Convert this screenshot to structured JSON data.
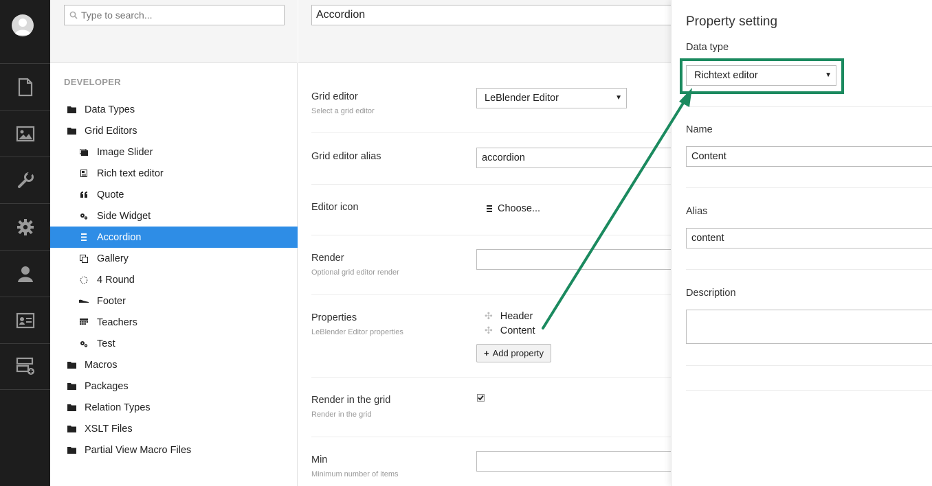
{
  "tree": {
    "search_placeholder": "Type to search...",
    "section_title": "DEVELOPER",
    "items": [
      {
        "label": "Data Types",
        "level": 1,
        "icon": "folder-icon"
      },
      {
        "label": "Grid Editors",
        "level": 1,
        "icon": "folder-icon"
      },
      {
        "label": "Image Slider",
        "level": 2,
        "icon": "image-slider-icon"
      },
      {
        "label": "Rich text editor",
        "level": 2,
        "icon": "rich-text-icon"
      },
      {
        "label": "Quote",
        "level": 2,
        "icon": "quote-icon"
      },
      {
        "label": "Side Widget",
        "level": 2,
        "icon": "cogs-icon"
      },
      {
        "label": "Accordion",
        "level": 2,
        "icon": "list-icon",
        "active": true
      },
      {
        "label": "Gallery",
        "level": 2,
        "icon": "gallery-icon"
      },
      {
        "label": "4 Round",
        "level": 2,
        "icon": "circle-dotted-icon"
      },
      {
        "label": "Footer",
        "level": 2,
        "icon": "footer-icon"
      },
      {
        "label": "Teachers",
        "level": 2,
        "icon": "calendar-icon"
      },
      {
        "label": "Test",
        "level": 2,
        "icon": "cogs-icon"
      },
      {
        "label": "Macros",
        "level": 1,
        "icon": "folder-icon"
      },
      {
        "label": "Packages",
        "level": 1,
        "icon": "folder-icon"
      },
      {
        "label": "Relation Types",
        "level": 1,
        "icon": "folder-icon"
      },
      {
        "label": "XSLT Files",
        "level": 1,
        "icon": "folder-icon"
      },
      {
        "label": "Partial View Macro Files",
        "level": 1,
        "icon": "folder-icon"
      }
    ]
  },
  "editor": {
    "name": "Accordion",
    "grid_editor_label": "Grid editor",
    "grid_editor_sub": "Select a grid editor",
    "grid_editor_value": "LeBlender Editor",
    "alias_label": "Grid editor alias",
    "alias_value": "accordion",
    "icon_label": "Editor icon",
    "icon_choose": "Choose...",
    "render_label": "Render",
    "render_sub": "Optional grid editor render",
    "render_value": "",
    "properties_label": "Properties",
    "properties_sub": "LeBlender Editor properties",
    "properties": [
      "Header",
      "Content"
    ],
    "add_property": "Add property",
    "render_grid_label": "Render in the grid",
    "render_grid_sub": "Render in the grid",
    "render_grid_checked": true,
    "min_label": "Min",
    "min_sub": "Minimum number of items",
    "min_value": ""
  },
  "panel": {
    "title": "Property setting",
    "data_type_label": "Data type",
    "data_type_value": "Richtext editor",
    "name_label": "Name",
    "name_value": "Content",
    "alias_label": "Alias",
    "alias_value": "content",
    "description_label": "Description",
    "description_value": ""
  },
  "colors": {
    "rail": "#1d1d1d",
    "active": "#2e8de6",
    "highlight": "#1b8a5f"
  }
}
